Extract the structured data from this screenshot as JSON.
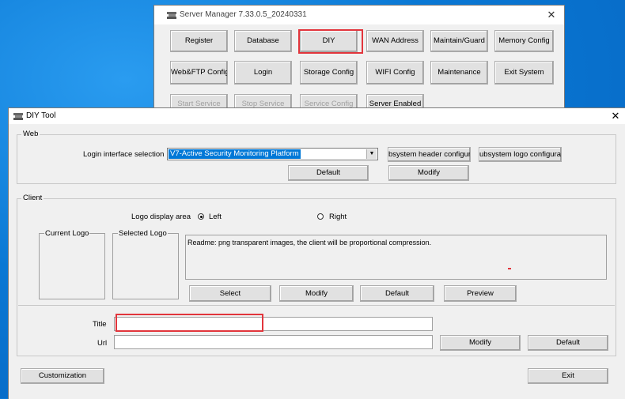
{
  "server_manager": {
    "title": "Server Manager 7.33.0.5_20240331",
    "close": "✕",
    "buttons": {
      "register": "Register",
      "database": "Database",
      "diy": "DIY",
      "wan_address": "WAN Address",
      "maintain_guard": "Maintain/Guard",
      "memory_config": "Memory Config",
      "web_ftp_config": "Web&FTP Config",
      "login": "Login",
      "storage_config": "Storage Config",
      "wifi_config": "WIFI Config",
      "maintenance": "Maintenance",
      "exit_system": "Exit System",
      "start_service": "Start Service",
      "stop_service": "Stop Service",
      "service_config": "Service Config",
      "server_enabled": "Server Enabled"
    }
  },
  "diy_tool": {
    "title": "DIY Tool",
    "close": "✕",
    "web": {
      "group_label": "Web",
      "login_interface_label": "Login interface selection",
      "login_interface_value": "V7-Active Security Monitoring Platform",
      "subsystem_header_button": "bsystem header configurat",
      "subsystem_logo_button": "ubsystem logo configuratic",
      "default_button": "Default",
      "modify_button": "Modify"
    },
    "client": {
      "group_label": "Client",
      "logo_display_area_label": "Logo display area",
      "left_option": "Left",
      "right_option": "Right",
      "selected_option": "Left",
      "current_logo_label": "Current Logo",
      "selected_logo_label": "Selected Logo",
      "readme": "Readme: png transparent images, the client will be proportional compression.",
      "select_button": "Select",
      "modify_button": "Modify",
      "default_button": "Default",
      "preview_button": "Preview"
    },
    "title_label": "Title",
    "title_value": "",
    "url_label": "Url",
    "url_value": "",
    "modify_button": "Modify",
    "default_button": "Default",
    "customization_button": "Customization",
    "exit_button": "Exit"
  },
  "colors": {
    "desktop": "#0a78d4",
    "highlight": "#e2353c",
    "selection": "#0078d7"
  }
}
